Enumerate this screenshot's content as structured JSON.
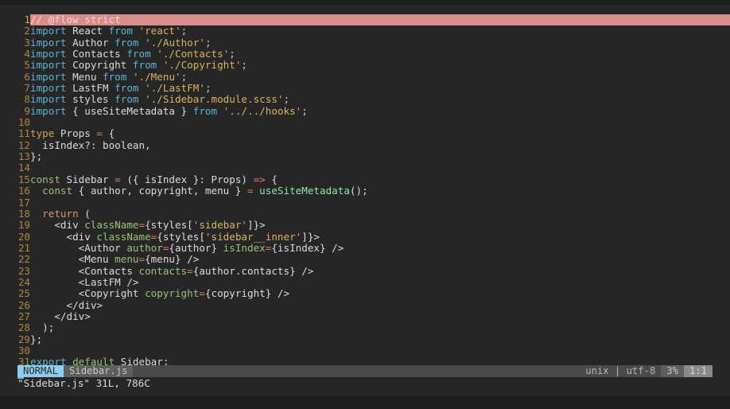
{
  "editor": {
    "app": "vim",
    "theme_background": "#262626",
    "cursorline_color": "#d98c8c",
    "linenumber_color": "#b0863c",
    "lines": [
      {
        "n": "1",
        "cursor": true,
        "tokens": [
          {
            "t": "// @flow strict",
            "c": "comment"
          }
        ]
      },
      {
        "n": "2",
        "cursor": false,
        "tokens": [
          {
            "t": "import",
            "c": "kw"
          },
          {
            "t": " React ",
            "c": "txt"
          },
          {
            "t": "from",
            "c": "kw"
          },
          {
            "t": " ",
            "c": "txt"
          },
          {
            "t": "'react'",
            "c": "str"
          },
          {
            "t": ";",
            "c": "punc"
          }
        ]
      },
      {
        "n": "3",
        "cursor": false,
        "tokens": [
          {
            "t": "import",
            "c": "kw"
          },
          {
            "t": " Author ",
            "c": "txt"
          },
          {
            "t": "from",
            "c": "kw"
          },
          {
            "t": " ",
            "c": "txt"
          },
          {
            "t": "'./Author'",
            "c": "str"
          },
          {
            "t": ";",
            "c": "punc"
          }
        ]
      },
      {
        "n": "4",
        "cursor": false,
        "tokens": [
          {
            "t": "import",
            "c": "kw"
          },
          {
            "t": " Contacts ",
            "c": "txt"
          },
          {
            "t": "from",
            "c": "kw"
          },
          {
            "t": " ",
            "c": "txt"
          },
          {
            "t": "'./Contacts'",
            "c": "str"
          },
          {
            "t": ";",
            "c": "punc"
          }
        ]
      },
      {
        "n": "5",
        "cursor": false,
        "tokens": [
          {
            "t": "import",
            "c": "kw"
          },
          {
            "t": " Copyright ",
            "c": "txt"
          },
          {
            "t": "from",
            "c": "kw"
          },
          {
            "t": " ",
            "c": "txt"
          },
          {
            "t": "'./Copyright'",
            "c": "str"
          },
          {
            "t": ";",
            "c": "punc"
          }
        ]
      },
      {
        "n": "6",
        "cursor": false,
        "tokens": [
          {
            "t": "import",
            "c": "kw"
          },
          {
            "t": " Menu ",
            "c": "txt"
          },
          {
            "t": "from",
            "c": "kw"
          },
          {
            "t": " ",
            "c": "txt"
          },
          {
            "t": "'./Menu'",
            "c": "str"
          },
          {
            "t": ";",
            "c": "punc"
          }
        ]
      },
      {
        "n": "7",
        "cursor": false,
        "tokens": [
          {
            "t": "import",
            "c": "kw"
          },
          {
            "t": " LastFM ",
            "c": "txt"
          },
          {
            "t": "from",
            "c": "kw"
          },
          {
            "t": " ",
            "c": "txt"
          },
          {
            "t": "'./LastFM'",
            "c": "str"
          },
          {
            "t": ";",
            "c": "punc"
          }
        ]
      },
      {
        "n": "8",
        "cursor": false,
        "tokens": [
          {
            "t": "import",
            "c": "kw"
          },
          {
            "t": " styles ",
            "c": "txt"
          },
          {
            "t": "from",
            "c": "kw"
          },
          {
            "t": " ",
            "c": "txt"
          },
          {
            "t": "'./Sidebar.module.scss'",
            "c": "str"
          },
          {
            "t": ";",
            "c": "punc"
          }
        ]
      },
      {
        "n": "9",
        "cursor": false,
        "tokens": [
          {
            "t": "import",
            "c": "kw"
          },
          {
            "t": " { useSiteMetadata } ",
            "c": "txt"
          },
          {
            "t": "from",
            "c": "kw"
          },
          {
            "t": " ",
            "c": "txt"
          },
          {
            "t": "'../../hooks'",
            "c": "str"
          },
          {
            "t": ";",
            "c": "punc"
          }
        ]
      },
      {
        "n": "10",
        "cursor": false,
        "tokens": []
      },
      {
        "n": "11",
        "cursor": false,
        "tokens": [
          {
            "t": "type",
            "c": "ret"
          },
          {
            "t": " Props ",
            "c": "txt"
          },
          {
            "t": "=",
            "c": "op"
          },
          {
            "t": " {",
            "c": "txt"
          }
        ]
      },
      {
        "n": "12",
        "cursor": false,
        "tokens": [
          {
            "t": "  isIndex?: boolean,",
            "c": "txt"
          }
        ]
      },
      {
        "n": "13",
        "cursor": false,
        "tokens": [
          {
            "t": "};",
            "c": "txt"
          }
        ]
      },
      {
        "n": "14",
        "cursor": false,
        "tokens": []
      },
      {
        "n": "15",
        "cursor": false,
        "tokens": [
          {
            "t": "const",
            "c": "kw2"
          },
          {
            "t": " Sidebar ",
            "c": "txt"
          },
          {
            "t": "=",
            "c": "op"
          },
          {
            "t": " ({ isIndex }: Props) ",
            "c": "txt"
          },
          {
            "t": "=>",
            "c": "op"
          },
          {
            "t": " {",
            "c": "txt"
          }
        ]
      },
      {
        "n": "16",
        "cursor": false,
        "tokens": [
          {
            "t": "  ",
            "c": "txt"
          },
          {
            "t": "const",
            "c": "kw2"
          },
          {
            "t": " { author, copyright, menu } ",
            "c": "txt"
          },
          {
            "t": "=",
            "c": "op"
          },
          {
            "t": " ",
            "c": "txt"
          },
          {
            "t": "useSiteMetadata",
            "c": "fn"
          },
          {
            "t": "();",
            "c": "txt"
          }
        ]
      },
      {
        "n": "17",
        "cursor": false,
        "tokens": []
      },
      {
        "n": "18",
        "cursor": false,
        "tokens": [
          {
            "t": "  ",
            "c": "txt"
          },
          {
            "t": "return",
            "c": "ret"
          },
          {
            "t": " (",
            "c": "txt"
          }
        ]
      },
      {
        "n": "19",
        "cursor": false,
        "tokens": [
          {
            "t": "    <div ",
            "c": "txt"
          },
          {
            "t": "className",
            "c": "prop"
          },
          {
            "t": "=",
            "c": "op"
          },
          {
            "t": "{styles[",
            "c": "txt"
          },
          {
            "t": "'sidebar'",
            "c": "str"
          },
          {
            "t": "]}>",
            "c": "txt"
          }
        ]
      },
      {
        "n": "20",
        "cursor": false,
        "tokens": [
          {
            "t": "      <div ",
            "c": "txt"
          },
          {
            "t": "className",
            "c": "prop"
          },
          {
            "t": "=",
            "c": "op"
          },
          {
            "t": "{styles[",
            "c": "txt"
          },
          {
            "t": "'sidebar__inner'",
            "c": "str"
          },
          {
            "t": "]}>",
            "c": "txt"
          }
        ]
      },
      {
        "n": "21",
        "cursor": false,
        "tokens": [
          {
            "t": "        <Author ",
            "c": "txt"
          },
          {
            "t": "author",
            "c": "prop"
          },
          {
            "t": "=",
            "c": "op"
          },
          {
            "t": "{author} ",
            "c": "txt"
          },
          {
            "t": "isIndex",
            "c": "prop"
          },
          {
            "t": "=",
            "c": "op"
          },
          {
            "t": "{isIndex} />",
            "c": "txt"
          }
        ]
      },
      {
        "n": "22",
        "cursor": false,
        "tokens": [
          {
            "t": "        <Menu ",
            "c": "txt"
          },
          {
            "t": "menu",
            "c": "prop"
          },
          {
            "t": "=",
            "c": "op"
          },
          {
            "t": "{menu} />",
            "c": "txt"
          }
        ]
      },
      {
        "n": "23",
        "cursor": false,
        "tokens": [
          {
            "t": "        <Contacts ",
            "c": "txt"
          },
          {
            "t": "contacts",
            "c": "prop"
          },
          {
            "t": "=",
            "c": "op"
          },
          {
            "t": "{author.contacts} />",
            "c": "txt"
          }
        ]
      },
      {
        "n": "24",
        "cursor": false,
        "tokens": [
          {
            "t": "        <LastFM />",
            "c": "txt"
          }
        ]
      },
      {
        "n": "25",
        "cursor": false,
        "tokens": [
          {
            "t": "        <Copyright ",
            "c": "txt"
          },
          {
            "t": "copyright",
            "c": "prop"
          },
          {
            "t": "=",
            "c": "op"
          },
          {
            "t": "{copyright} />",
            "c": "txt"
          }
        ]
      },
      {
        "n": "26",
        "cursor": false,
        "tokens": [
          {
            "t": "      </div>",
            "c": "txt"
          }
        ]
      },
      {
        "n": "27",
        "cursor": false,
        "tokens": [
          {
            "t": "    </div>",
            "c": "txt"
          }
        ]
      },
      {
        "n": "28",
        "cursor": false,
        "tokens": [
          {
            "t": "  );",
            "c": "txt"
          }
        ]
      },
      {
        "n": "29",
        "cursor": false,
        "tokens": [
          {
            "t": "};",
            "c": "txt"
          }
        ]
      },
      {
        "n": "30",
        "cursor": false,
        "tokens": []
      },
      {
        "n": "31",
        "cursor": false,
        "tokens": [
          {
            "t": "export",
            "c": "kw"
          },
          {
            "t": " ",
            "c": "txt"
          },
          {
            "t": "default",
            "c": "kw2"
          },
          {
            "t": " Sidebar;",
            "c": "txt"
          }
        ]
      }
    ]
  },
  "statusline": {
    "mode": "NORMAL",
    "filename": "Sidebar.js",
    "fileformat": "unix | utf-8",
    "percent": "3%",
    "position": "1:1",
    "mode_bg": "#8ecdf0",
    "file_bg": "#5e5e5e",
    "pos_bg": "#8a8a8a"
  },
  "messageline": {
    "text": "\"Sidebar.js\" 31L, 786C"
  }
}
